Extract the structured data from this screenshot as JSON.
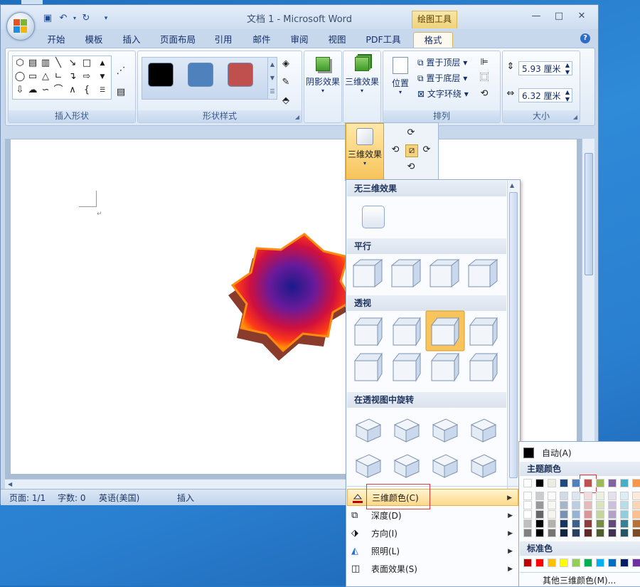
{
  "window": {
    "title": "文档 1 - Microsoft Word",
    "context_tab_header": "绘图工具",
    "controls": [
      "—",
      "□",
      "✕"
    ]
  },
  "tabs": [
    {
      "label": "开始",
      "active": false
    },
    {
      "label": "模板",
      "active": false
    },
    {
      "label": "插入",
      "active": false
    },
    {
      "label": "页面布局",
      "active": false
    },
    {
      "label": "引用",
      "active": false
    },
    {
      "label": "邮件",
      "active": false
    },
    {
      "label": "审阅",
      "active": false
    },
    {
      "label": "视图",
      "active": false
    },
    {
      "label": "PDF工具",
      "active": false
    },
    {
      "label": "格式",
      "active": true
    }
  ],
  "ribbon": {
    "insert_shapes_label": "插入形状",
    "shape_styles_label": "形状样式",
    "style_swatches": [
      "#000000",
      "#4f81bd",
      "#c0504d"
    ],
    "shadow_effects_label": "阴影效果",
    "three_d_effects_label": "三维效果",
    "arrange": {
      "label": "排列",
      "position_label": "位置",
      "bring_front": "置于顶层",
      "send_back": "置于底层",
      "text_wrap": "文字环绕"
    },
    "size": {
      "label": "大小",
      "height": "5.93 厘米",
      "width": "6.32 厘米"
    }
  },
  "three_d_popup": {
    "label": "三维效果"
  },
  "gallery": {
    "sections": [
      {
        "title": "无三维效果"
      },
      {
        "title": "平行"
      },
      {
        "title": "透视"
      },
      {
        "title": "在透视图中旋转"
      }
    ],
    "menu": [
      {
        "label": "三维颜色(C)",
        "highlighted": true
      },
      {
        "label": "深度(D)",
        "highlighted": false
      },
      {
        "label": "方向(I)",
        "highlighted": false
      },
      {
        "label": "照明(L)",
        "highlighted": false
      },
      {
        "label": "表面效果(S)",
        "highlighted": false
      }
    ]
  },
  "color_picker": {
    "auto_label": "自动(A)",
    "theme_colors_label": "主题颜色",
    "standard_colors_label": "标准色",
    "more_colors_label": "其他三维颜色(M)...",
    "theme_row": [
      "#ffffff",
      "#000000",
      "#eeece1",
      "#1f497d",
      "#4f81bd",
      "#c0504d",
      "#9bbb59",
      "#8064a2",
      "#4bacc6",
      "#f79646"
    ],
    "selected_color": "#c0504d",
    "standard_row": [
      "#c00000",
      "#ff0000",
      "#ffc000",
      "#ffff00",
      "#92d050",
      "#00b050",
      "#00b0f0",
      "#0070c0",
      "#002060",
      "#7030a0"
    ]
  },
  "status": {
    "page": "页面: 1/1",
    "words": "字数: 0",
    "language": "英语(美国)",
    "mode": "插入"
  }
}
